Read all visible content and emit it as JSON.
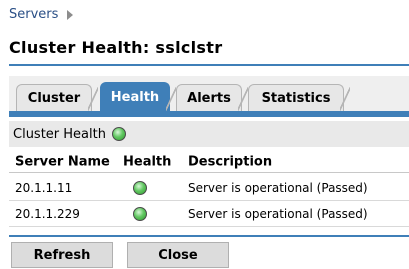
{
  "breadcrumb": {
    "label": "Servers"
  },
  "page": {
    "title": "Cluster Health: sslclstr"
  },
  "tabs": [
    {
      "label": "Cluster"
    },
    {
      "label": "Health"
    },
    {
      "label": "Alerts"
    },
    {
      "label": "Statistics"
    }
  ],
  "active_tab": "Health",
  "section": {
    "label": "Cluster Health",
    "status_icon": "green-status-icon"
  },
  "table": {
    "headers": [
      "Server Name",
      "Health",
      "Description"
    ],
    "rows": [
      {
        "server": "20.1.1.11",
        "health": "green-status-icon",
        "description": "Server is operational (Passed)"
      },
      {
        "server": "20.1.1.229",
        "health": "green-status-icon",
        "description": "Server is operational (Passed)"
      }
    ]
  },
  "buttons": {
    "refresh": "Refresh",
    "close": "Close"
  },
  "colors": {
    "accent": "#3f7fb8",
    "status_ok": "#62c862",
    "link": "#2a4f86"
  }
}
